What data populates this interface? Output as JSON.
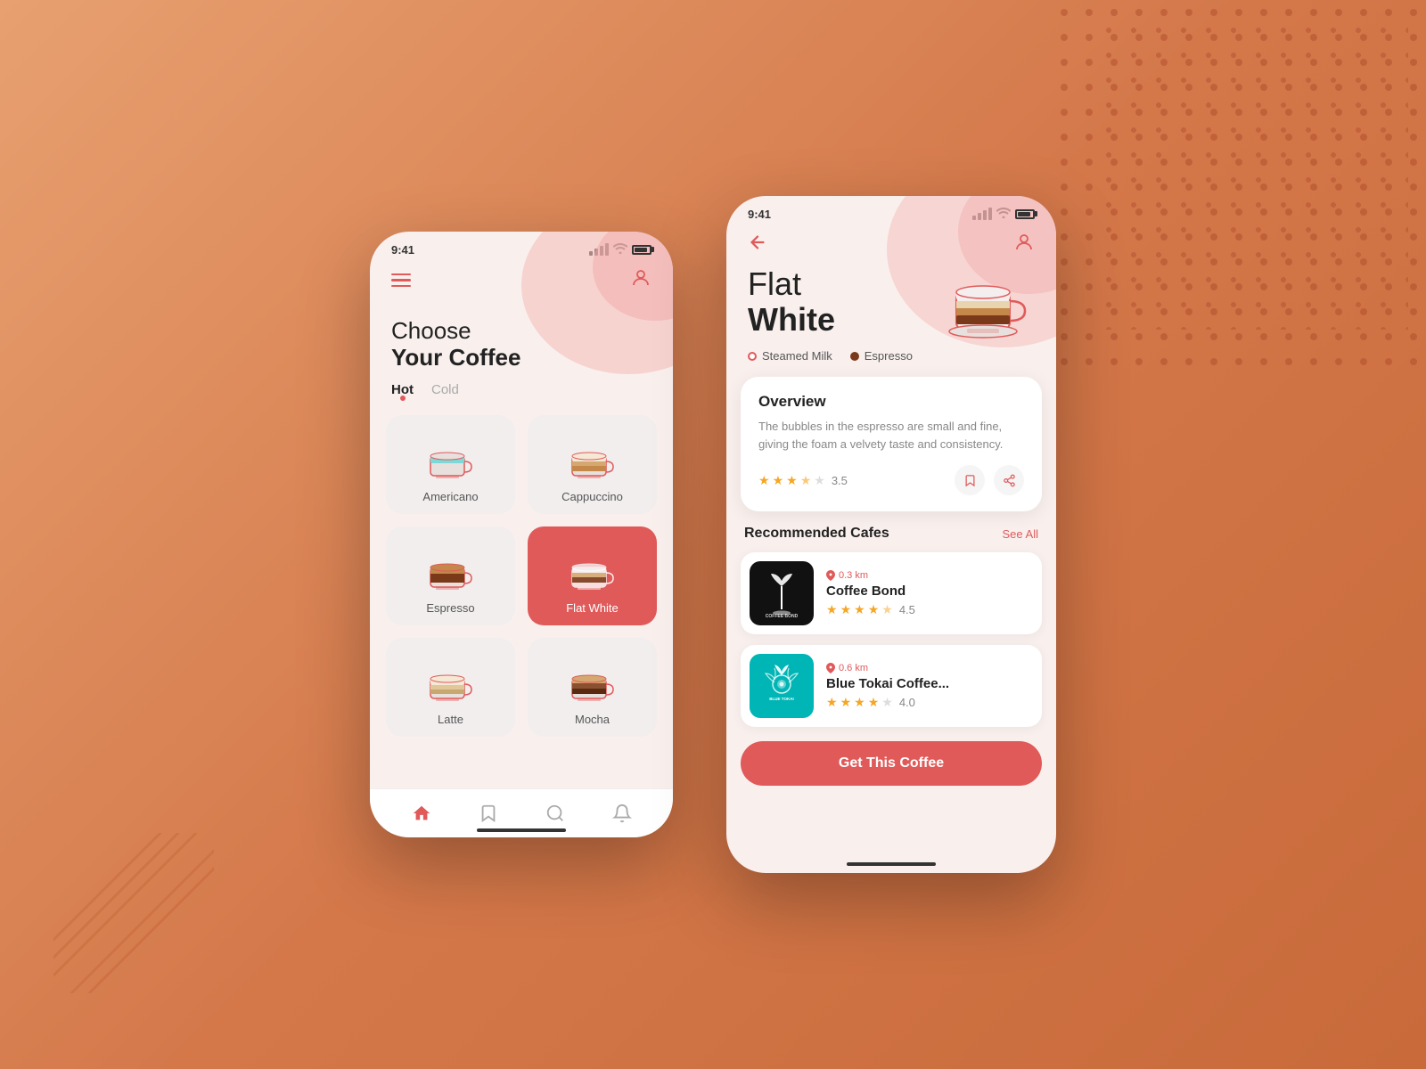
{
  "background": {
    "gradient_start": "#e8a070",
    "gradient_end": "#c86a3a"
  },
  "phone1": {
    "status_time": "9:41",
    "title_line1": "Choose",
    "title_line2": "Your Coffee",
    "filter_hot": "Hot",
    "filter_cold": "Cold",
    "coffees": [
      {
        "name": "Americano",
        "selected": false,
        "cup_color": "teal"
      },
      {
        "name": "Cappuccino",
        "selected": false,
        "cup_color": "beige"
      },
      {
        "name": "Espresso",
        "selected": false,
        "cup_color": "brown"
      },
      {
        "name": "Flat White",
        "selected": true,
        "cup_color": "layered"
      },
      {
        "name": "Latte",
        "selected": false,
        "cup_color": "light"
      },
      {
        "name": "Mocha",
        "selected": false,
        "cup_color": "dark"
      }
    ],
    "nav": {
      "home": "home",
      "bookmark": "bookmark",
      "search": "search",
      "bell": "bell"
    }
  },
  "phone2": {
    "status_time": "9:41",
    "title_line1": "Flat",
    "title_line2": "White",
    "ingredients": [
      {
        "name": "Steamed Milk",
        "color": "outline"
      },
      {
        "name": "Espresso",
        "color": "dark-brown"
      }
    ],
    "overview": {
      "title": "Overview",
      "text": "The bubbles in the espresso are small and fine, giving the foam a velvety taste and consistency.",
      "rating": "3.5",
      "stars_filled": 3,
      "stars_half": 1,
      "stars_empty": 1
    },
    "recommended_title": "Recommended Cafes",
    "see_all": "See All",
    "cafes": [
      {
        "name": "Coffee Bond",
        "distance": "0.3 km",
        "rating": "4.5",
        "stars_filled": 4,
        "stars_half": 1,
        "stars_empty": 0,
        "logo_text": "COFFEE BOND",
        "logo_bg": "black"
      },
      {
        "name": "Blue Tokai Coffee...",
        "distance": "0.6 km",
        "rating": "4.0",
        "stars_filled": 4,
        "stars_half": 0,
        "stars_empty": 1,
        "logo_text": "BLUE TOKAI",
        "logo_bg": "teal"
      }
    ],
    "cta_button": "Get This Coffee"
  }
}
